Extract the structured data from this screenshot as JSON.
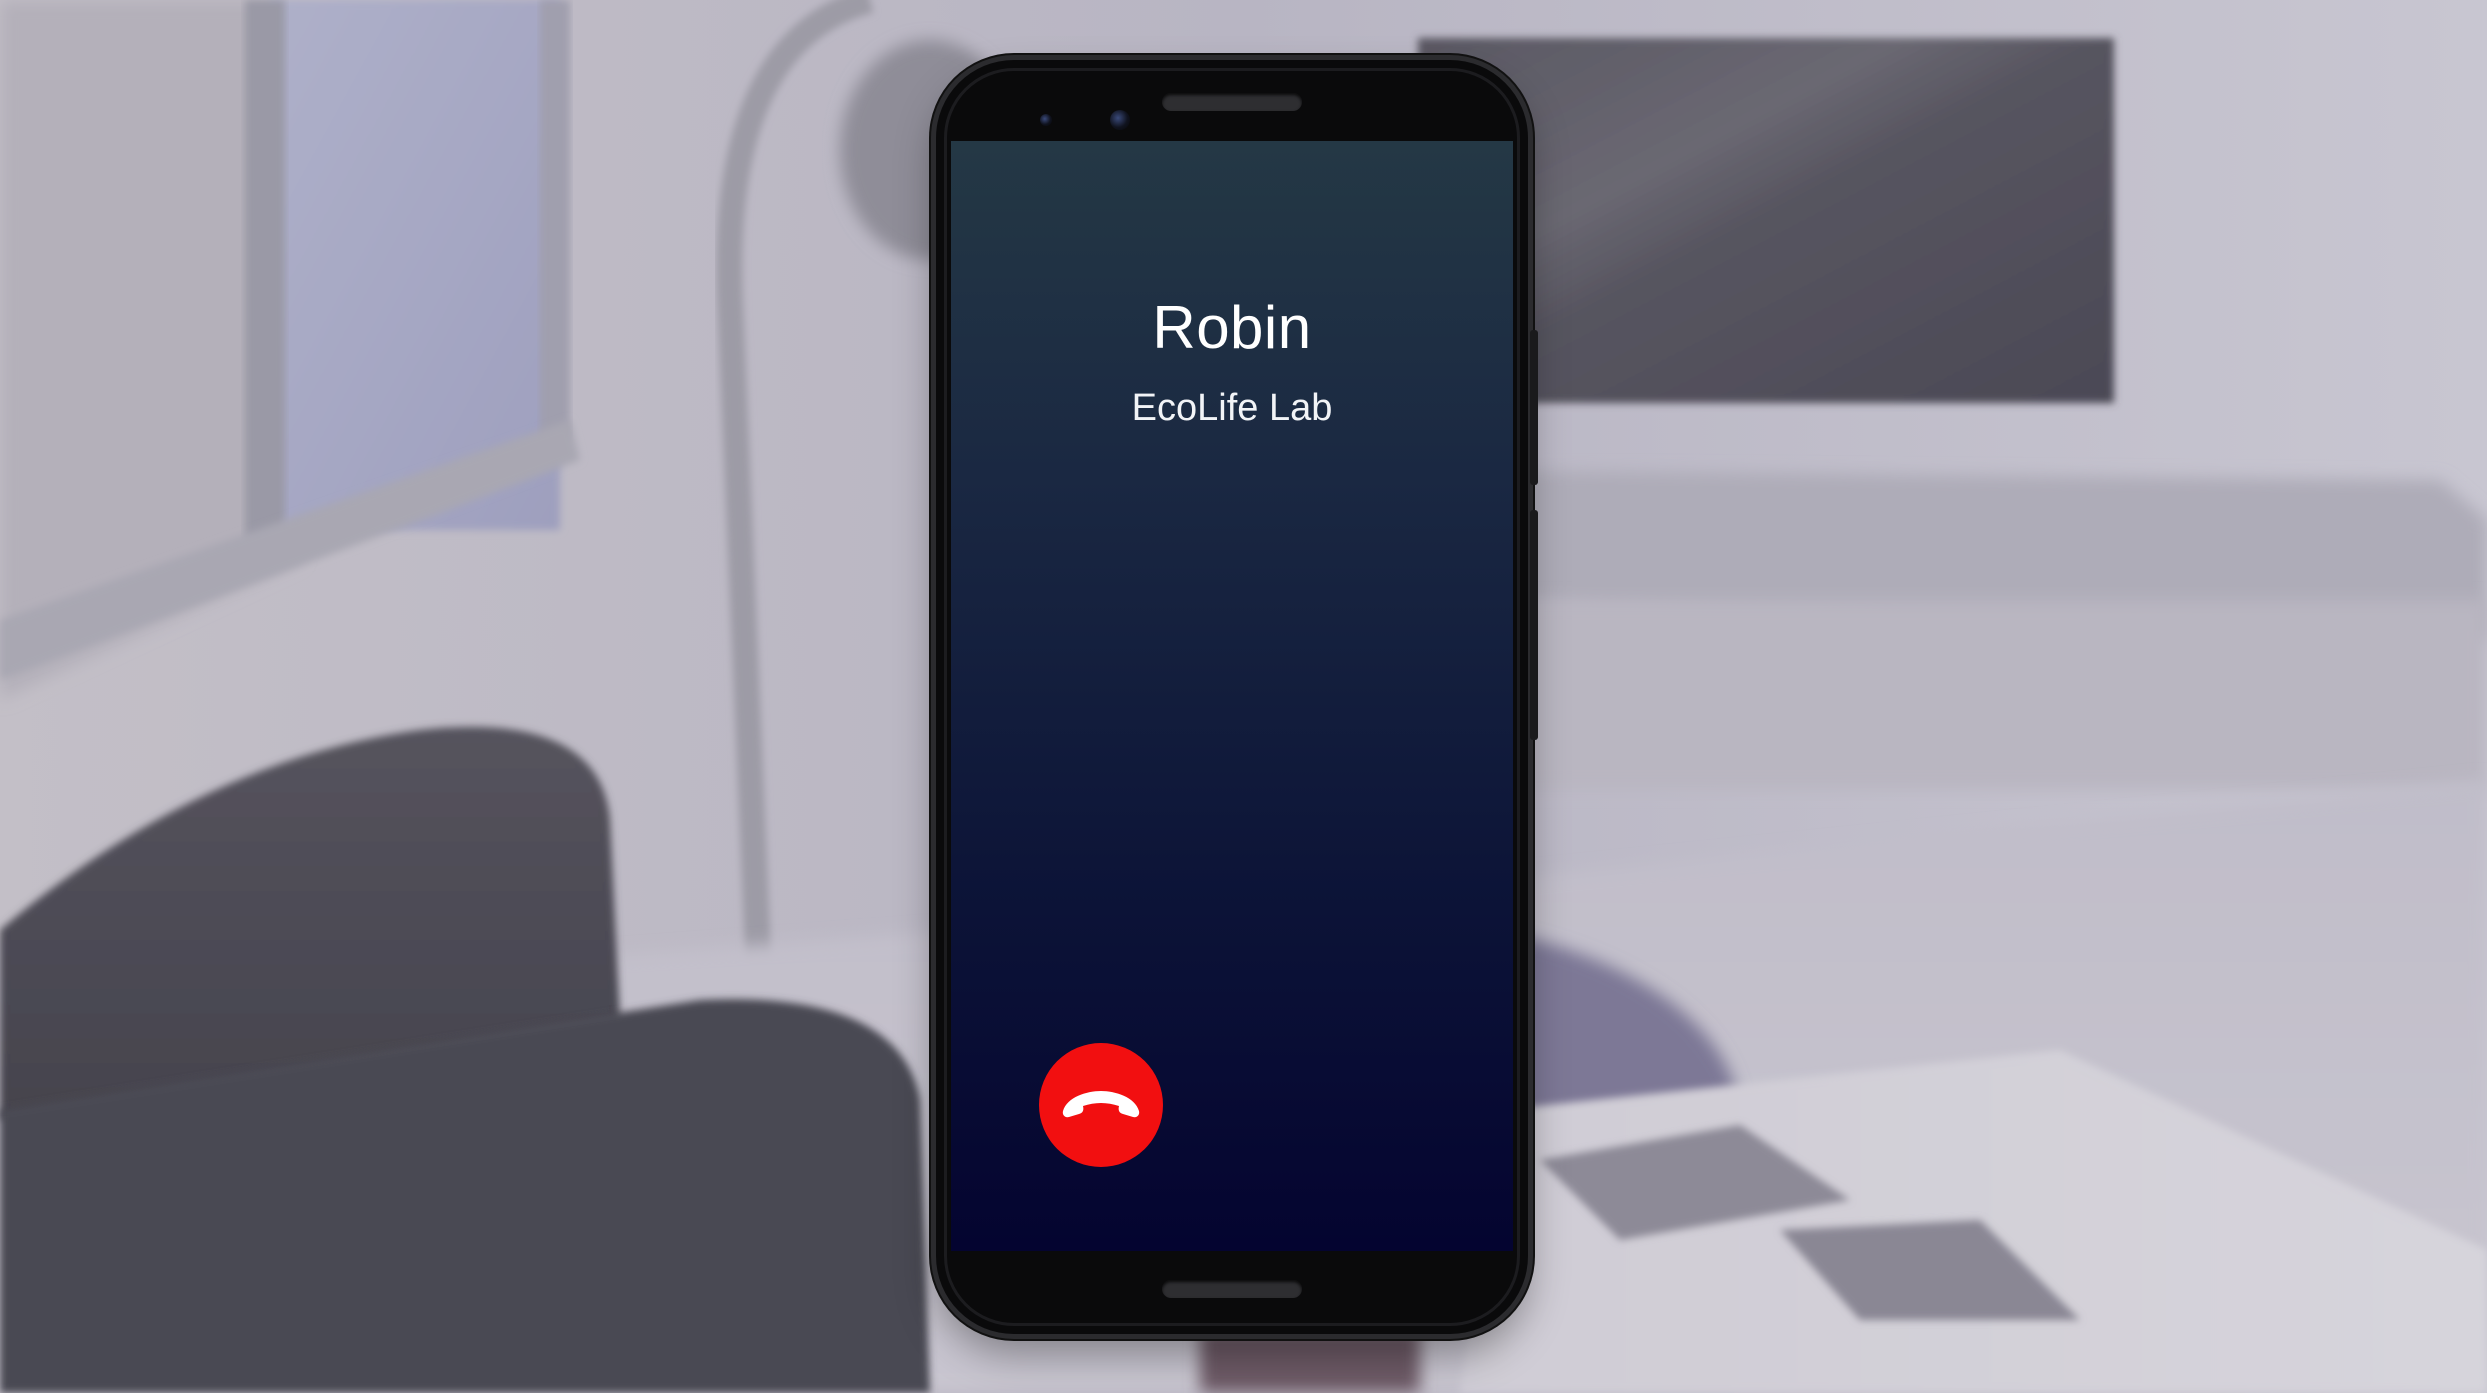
{
  "call_screen": {
    "caller_name": "Robin",
    "caller_organization": "EcoLife Lab",
    "end_call_icon": "phone-hangup-icon"
  },
  "colors": {
    "end_call_red": "#f20f10",
    "screen_gradient_top": "#243845",
    "screen_gradient_bottom": "#040430",
    "text_white": "#ffffff"
  }
}
